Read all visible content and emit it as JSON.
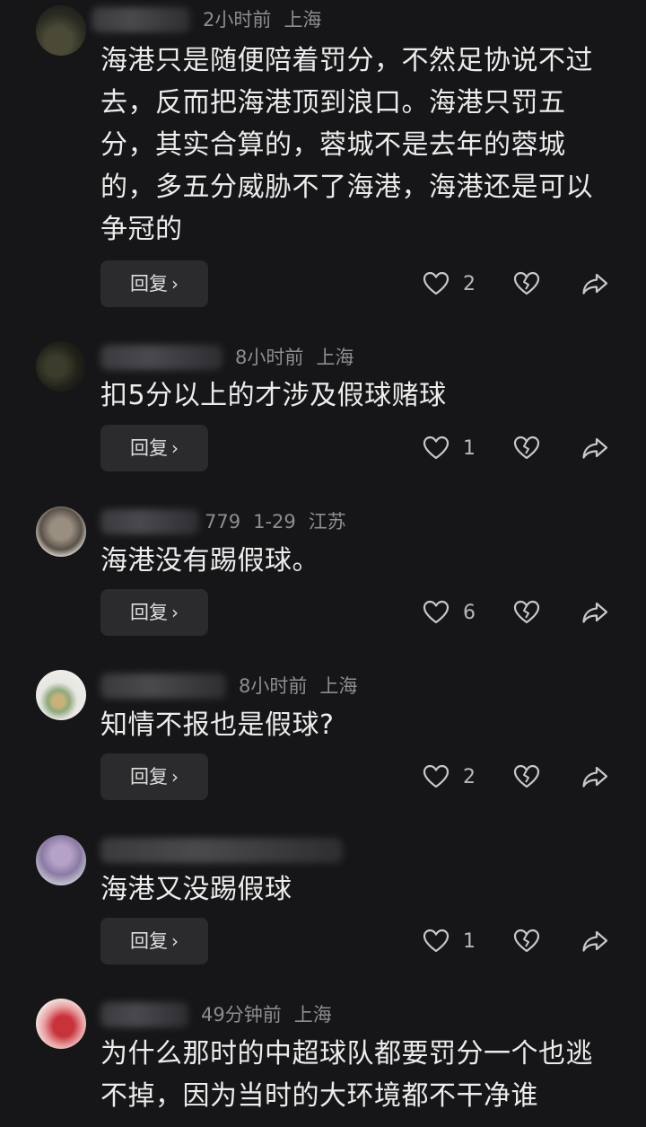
{
  "comments": [
    {
      "meta_prefix": "",
      "time": "2小时前",
      "location": "上海",
      "text": "海港只是随便陪着罚分，不然足协说不过去，反而把海港顶到浪口。海港只罚五分，其实合算的，蓉城不是去年的蓉城的，多五分威胁不了海港，海港还是可以争冠的",
      "reply_label": "回复",
      "likes": "2"
    },
    {
      "meta_prefix": "",
      "time": "8小时前",
      "location": "上海",
      "text": "扣5分以上的才涉及假球赌球",
      "reply_label": "回复",
      "likes": "1"
    },
    {
      "meta_prefix": "779",
      "time": "1-29",
      "location": "江苏",
      "text": "海港没有踢假球。",
      "reply_label": "回复",
      "likes": "6"
    },
    {
      "meta_prefix": "",
      "time": "8小时前",
      "location": "上海",
      "text": "知情不报也是假球?",
      "reply_label": "回复",
      "likes": "2"
    },
    {
      "meta_prefix": "",
      "time": "",
      "location": "",
      "text": "海港又没踢假球",
      "reply_label": "回复",
      "likes": "1"
    },
    {
      "meta_prefix": "",
      "time": "49分钟前",
      "location": "上海",
      "text": "为什么那时的中超球队都要罚分一个也逃不掉，因为当时的大环境都不干净谁",
      "reply_label": "",
      "likes": ""
    }
  ],
  "icons": {
    "like": "heart-icon",
    "dislike": "broken-heart-icon",
    "share": "share-arrow-icon",
    "reply_chevron": "chevron-right-icon"
  }
}
